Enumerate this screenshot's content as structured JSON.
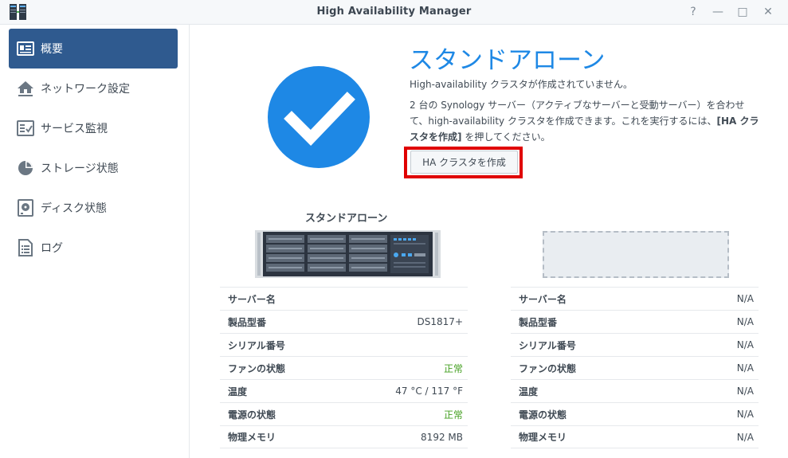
{
  "window": {
    "title": "High Availability Manager",
    "controls": [
      "?",
      "—",
      "□",
      "✕"
    ]
  },
  "sidebar": {
    "items": [
      {
        "label": "概要",
        "icon": "overview-card-icon",
        "active": true
      },
      {
        "label": "ネットワーク設定",
        "icon": "network-home-icon",
        "active": false
      },
      {
        "label": "サービス監視",
        "icon": "service-monitor-icon",
        "active": false
      },
      {
        "label": "ストレージ状態",
        "icon": "storage-pie-icon",
        "active": false
      },
      {
        "label": "ディスク状態",
        "icon": "disk-icon",
        "active": false
      },
      {
        "label": "ログ",
        "icon": "log-icon",
        "active": false
      }
    ]
  },
  "main": {
    "status_title": "スタンドアローン",
    "desc1": "High-availability クラスタが作成されていません。",
    "desc2_prefix": "2 台の Synology サーバー（アクティブなサーバーと受動サーバー）を合わせて、high-availability クラスタを作成できます。これを実行するには、",
    "desc2_bold": "[HA クラスタを作成]",
    "desc2_suffix": " を押してください。",
    "create_button": "HA クラスタを作成",
    "server_caption": "スタンドアローン"
  },
  "left_table": [
    {
      "key": "サーバー名",
      "value": "",
      "ok": false
    },
    {
      "key": "製品型番",
      "value": "DS1817+",
      "ok": false
    },
    {
      "key": "シリアル番号",
      "value": "",
      "ok": false
    },
    {
      "key": "ファンの状態",
      "value": "正常",
      "ok": true
    },
    {
      "key": "温度",
      "value": "47 °C / 117 °F",
      "ok": false
    },
    {
      "key": "電源の状態",
      "value": "正常",
      "ok": true
    },
    {
      "key": "物理メモリ",
      "value": "8192 MB",
      "ok": false
    }
  ],
  "right_table": [
    {
      "key": "サーバー名",
      "value": "N/A"
    },
    {
      "key": "製品型番",
      "value": "N/A"
    },
    {
      "key": "シリアル番号",
      "value": "N/A"
    },
    {
      "key": "ファンの状態",
      "value": "N/A"
    },
    {
      "key": "温度",
      "value": "N/A"
    },
    {
      "key": "電源の状態",
      "value": "N/A"
    },
    {
      "key": "物理メモリ",
      "value": "N/A"
    }
  ],
  "colors": {
    "accent": "#1e88e5",
    "sidebar_active": "#2f5a8f",
    "ok_green": "#45a022",
    "highlight_red": "#e00000"
  }
}
